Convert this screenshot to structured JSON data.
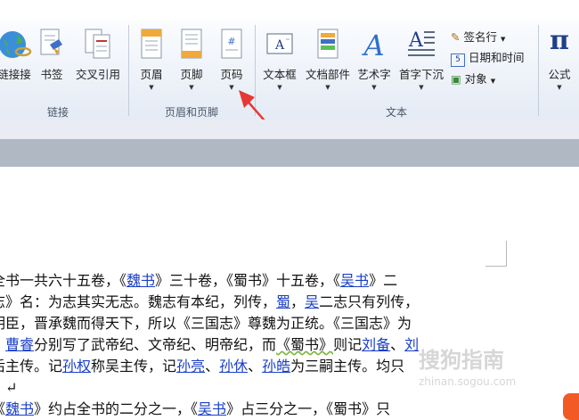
{
  "ribbon": {
    "links_group": {
      "label": "链接",
      "hyperlink": "链接接",
      "bookmark": "书签",
      "crossref": "交叉引用"
    },
    "header_footer_group": {
      "label": "页眉和页脚",
      "header": "页眉",
      "footer": "页脚",
      "page_number": "页码"
    },
    "text_group": {
      "label": "文本",
      "textbox": "文本框",
      "quick_parts": "文档部件",
      "wordart": "艺术字",
      "dropcap": "首字下沉",
      "signature_line": "签名行",
      "date_time": "日期和时间",
      "object": "对象"
    },
    "symbols_group": {
      "equation": "公式",
      "equation_glyph": "π"
    }
  },
  "document": {
    "lines": [
      [
        "全书一共六十五卷，《",
        "魏书",
        "》三十卷，《蜀书》十五卷，《",
        "吴书",
        "》二"
      ],
      [
        "志》名：为志其实无志。魏志有本纪，列传，",
        "蜀",
        "，",
        "吴",
        "二志只有列传，"
      ],
      [
        "明臣，晋承魏而得天下，所以《三国志》尊魏为正统。《三国志》为"
      ],
      [
        "、",
        "曹睿",
        "分别写了武帝纪、文帝纪、明帝纪，而",
        "《蜀书》",
        "则记",
        "刘备",
        "、",
        "刘"
      ],
      [
        "后主传。记",
        "孙权",
        "称吴主传，记",
        "孙亮",
        "、",
        "孙休",
        "、",
        "孙皓",
        "为三嗣主传。均只"
      ],
      [
        "。↵"
      ],
      [
        "《",
        "魏书",
        "》约占全书的二分之一，《",
        "吴书",
        "》占三分之一，《蜀书》只"
      ]
    ]
  },
  "watermark": {
    "text": "搜狗指南",
    "url": "zhinan.sogou.com"
  },
  "colors": {
    "ribbon_bg": "#e4ebf5",
    "link": "#1a3fc8",
    "annotation_arrow": "#e53935"
  }
}
